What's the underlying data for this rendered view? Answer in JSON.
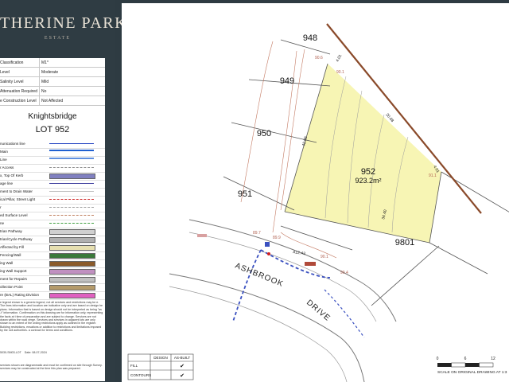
{
  "brand": {
    "title": "THERINE PARK",
    "subtitle": "ESTATE"
  },
  "sheet": {
    "info_rows": [
      {
        "key": "Classification",
        "value": "M1*"
      },
      {
        "key": "Level",
        "value": "Moderate"
      },
      {
        "key": "Salinity Level",
        "value": "Mild"
      },
      {
        "key": "Attenuation Required",
        "value": "No"
      },
      {
        "key": "e Construction Level",
        "value": "Not Affected"
      }
    ],
    "street": "Knightsbridge",
    "lot_label": "LOT 952",
    "legend": [
      "nunications line",
      "Main",
      "Line",
      "r Access",
      "x, Top Of Kerb",
      "age line",
      "ment to Drain Water",
      "ical Pillar, Street Light",
      "r",
      "ed Surface Level",
      "ne",
      "trian Pathway",
      "trian/Cycle Pathway",
      "Affected by Fill",
      "Fencing/Wall",
      "ing Wall",
      "ing Wall Support",
      "ment for Repairs",
      "ollection Point",
      "re (BAL) Rating Division"
    ],
    "notes": "e legend shown is a generic legend, not all services and restrictions may be e. The lines information and location are indicative only and are based on design he plans. Information that is based on design should not be interpreted as being \"as -t\" information. Confirmation on this drawing are for information only, representing the facts at t time of preparation and are subject to change. Services are not drawn within the road verge. Services and services in adjacent lots are only shown to an extent of the ording restrictions apply as outlined in the register. Building restrictions, ensations or addition to restrictions and limitations imposed by the ncil authorities. a contract for terms and conditions.",
    "footer_ref": "5030-SM03-LOT",
    "footer_date": "Date: 08-07-2024",
    "footer_note": "services shown are diagrammatic and must be confirmed on site through Survey. services may be constructed at the time this plan was prepared."
  },
  "plan": {
    "lots": [
      {
        "id": "948"
      },
      {
        "id": "949"
      },
      {
        "id": "950"
      },
      {
        "id": "951"
      },
      {
        "id": "952",
        "area": "923.2m²"
      },
      {
        "id": "9801"
      }
    ],
    "streets": [
      "ASHBROOK",
      "DRIVE"
    ],
    "dimensions": [
      "4.01",
      "20.68",
      "4.01",
      "42.09",
      "34.40",
      "A12.43"
    ],
    "levels": [
      "90.1",
      "91.1",
      "89.7",
      "90.1",
      "90.4",
      "90.6",
      "89.9"
    ],
    "table": {
      "col_design": "DESIGN",
      "col_asbuilt": "AS-BUILT",
      "rows": [
        {
          "label": "FILL",
          "mark": "✔"
        },
        {
          "label": "CONTOURS",
          "mark": "✔"
        }
      ]
    },
    "scale": {
      "ticks": [
        "0",
        "6",
        "12"
      ],
      "caption": "SCALE ON ORIGINAL DRAWING AT 1:3"
    }
  }
}
